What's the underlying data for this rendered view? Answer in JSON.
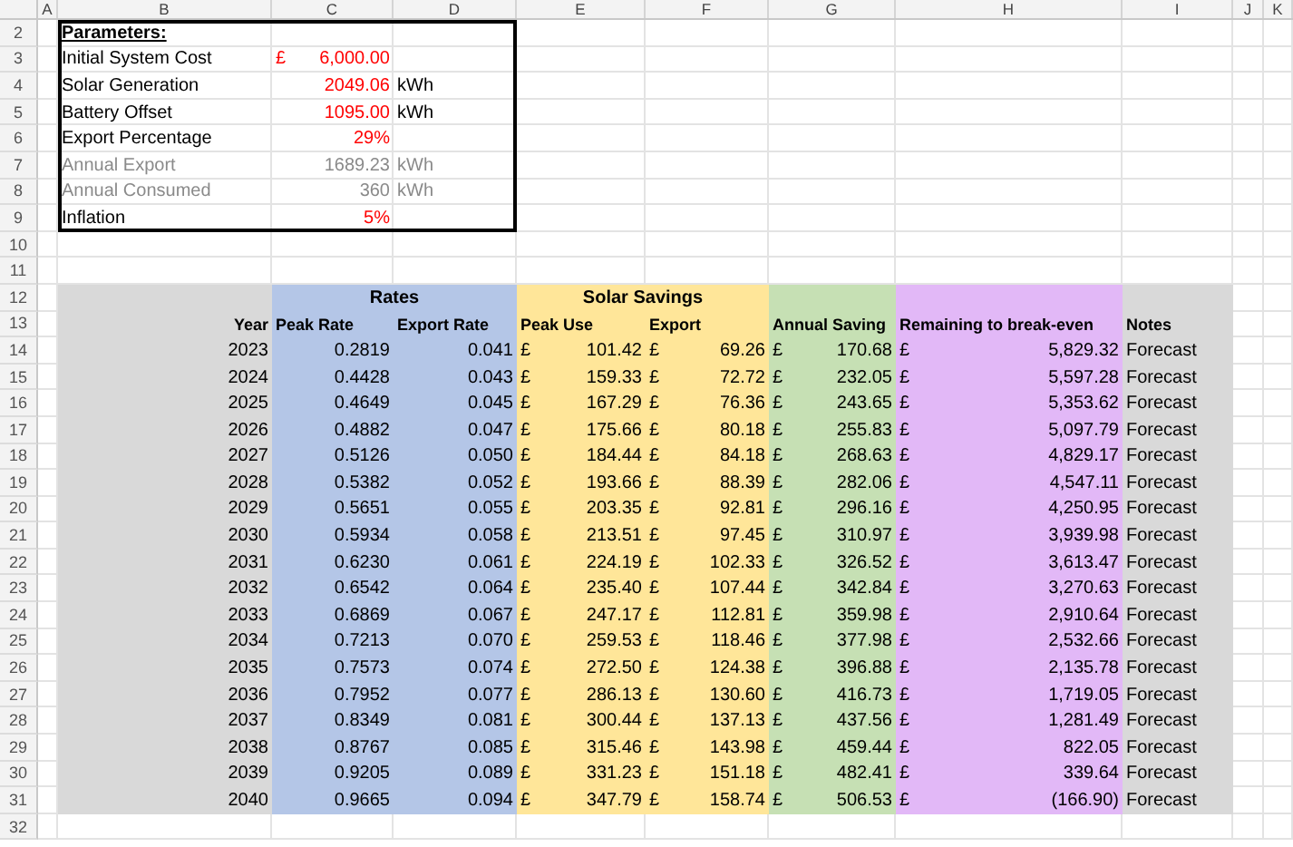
{
  "column_headers": [
    "A",
    "B",
    "C",
    "D",
    "E",
    "F",
    "G",
    "H",
    "I",
    "J",
    "K"
  ],
  "row_numbers": [
    "2",
    "3",
    "4",
    "5",
    "6",
    "7",
    "8",
    "9",
    "10",
    "11",
    "12",
    "13",
    "14",
    "15",
    "16",
    "17",
    "18",
    "19",
    "20",
    "21",
    "22",
    "23",
    "24",
    "25",
    "26",
    "27",
    "28",
    "29",
    "30",
    "31",
    "32"
  ],
  "parameters": {
    "title": "Parameters:",
    "items": [
      {
        "label": "Initial System Cost",
        "currency": "£",
        "value": "6,000.00",
        "muted": false
      },
      {
        "label": "Solar Generation",
        "value": "2049.06",
        "unit": "kWh",
        "muted": false
      },
      {
        "label": "Battery Offset",
        "value": "1095.00",
        "unit": "kWh",
        "muted": false
      },
      {
        "label": "Export Percentage",
        "value": "29%",
        "muted": false
      },
      {
        "label": "Annual Export",
        "value": "1689.23",
        "unit": "kWh",
        "muted": true
      },
      {
        "label": "Annual Consumed",
        "value": "360",
        "unit": "kWh",
        "muted": true
      },
      {
        "label": "Inflation",
        "value": "5%",
        "muted": false
      }
    ]
  },
  "table": {
    "groups": [
      "Rates",
      "Solar Savings"
    ],
    "columns": [
      "Year",
      "Peak Rate",
      "Export Rate",
      "Peak Use",
      "Export",
      "Annual Saving",
      "Remaining to break-even",
      "Notes"
    ],
    "rows": [
      {
        "year": "2023",
        "peak_rate": "0.2819",
        "export_rate": "0.041",
        "peak_use": [
          "£",
          "101.42"
        ],
        "export": [
          "£",
          "69.26"
        ],
        "annual_saving": [
          "£",
          "170.68"
        ],
        "remaining": [
          "£",
          "5,829.32"
        ],
        "notes": "Forecast"
      },
      {
        "year": "2024",
        "peak_rate": "0.4428",
        "export_rate": "0.043",
        "peak_use": [
          "£",
          "159.33"
        ],
        "export": [
          "£",
          "72.72"
        ],
        "annual_saving": [
          "£",
          "232.05"
        ],
        "remaining": [
          "£",
          "5,597.28"
        ],
        "notes": "Forecast"
      },
      {
        "year": "2025",
        "peak_rate": "0.4649",
        "export_rate": "0.045",
        "peak_use": [
          "£",
          "167.29"
        ],
        "export": [
          "£",
          "76.36"
        ],
        "annual_saving": [
          "£",
          "243.65"
        ],
        "remaining": [
          "£",
          "5,353.62"
        ],
        "notes": "Forecast"
      },
      {
        "year": "2026",
        "peak_rate": "0.4882",
        "export_rate": "0.047",
        "peak_use": [
          "£",
          "175.66"
        ],
        "export": [
          "£",
          "80.18"
        ],
        "annual_saving": [
          "£",
          "255.83"
        ],
        "remaining": [
          "£",
          "5,097.79"
        ],
        "notes": "Forecast"
      },
      {
        "year": "2027",
        "peak_rate": "0.5126",
        "export_rate": "0.050",
        "peak_use": [
          "£",
          "184.44"
        ],
        "export": [
          "£",
          "84.18"
        ],
        "annual_saving": [
          "£",
          "268.63"
        ],
        "remaining": [
          "£",
          "4,829.17"
        ],
        "notes": "Forecast"
      },
      {
        "year": "2028",
        "peak_rate": "0.5382",
        "export_rate": "0.052",
        "peak_use": [
          "£",
          "193.66"
        ],
        "export": [
          "£",
          "88.39"
        ],
        "annual_saving": [
          "£",
          "282.06"
        ],
        "remaining": [
          "£",
          "4,547.11"
        ],
        "notes": "Forecast"
      },
      {
        "year": "2029",
        "peak_rate": "0.5651",
        "export_rate": "0.055",
        "peak_use": [
          "£",
          "203.35"
        ],
        "export": [
          "£",
          "92.81"
        ],
        "annual_saving": [
          "£",
          "296.16"
        ],
        "remaining": [
          "£",
          "4,250.95"
        ],
        "notes": "Forecast"
      },
      {
        "year": "2030",
        "peak_rate": "0.5934",
        "export_rate": "0.058",
        "peak_use": [
          "£",
          "213.51"
        ],
        "export": [
          "£",
          "97.45"
        ],
        "annual_saving": [
          "£",
          "310.97"
        ],
        "remaining": [
          "£",
          "3,939.98"
        ],
        "notes": "Forecast"
      },
      {
        "year": "2031",
        "peak_rate": "0.6230",
        "export_rate": "0.061",
        "peak_use": [
          "£",
          "224.19"
        ],
        "export": [
          "£",
          "102.33"
        ],
        "annual_saving": [
          "£",
          "326.52"
        ],
        "remaining": [
          "£",
          "3,613.47"
        ],
        "notes": "Forecast"
      },
      {
        "year": "2032",
        "peak_rate": "0.6542",
        "export_rate": "0.064",
        "peak_use": [
          "£",
          "235.40"
        ],
        "export": [
          "£",
          "107.44"
        ],
        "annual_saving": [
          "£",
          "342.84"
        ],
        "remaining": [
          "£",
          "3,270.63"
        ],
        "notes": "Forecast"
      },
      {
        "year": "2033",
        "peak_rate": "0.6869",
        "export_rate": "0.067",
        "peak_use": [
          "£",
          "247.17"
        ],
        "export": [
          "£",
          "112.81"
        ],
        "annual_saving": [
          "£",
          "359.98"
        ],
        "remaining": [
          "£",
          "2,910.64"
        ],
        "notes": "Forecast"
      },
      {
        "year": "2034",
        "peak_rate": "0.7213",
        "export_rate": "0.070",
        "peak_use": [
          "£",
          "259.53"
        ],
        "export": [
          "£",
          "118.46"
        ],
        "annual_saving": [
          "£",
          "377.98"
        ],
        "remaining": [
          "£",
          "2,532.66"
        ],
        "notes": "Forecast"
      },
      {
        "year": "2035",
        "peak_rate": "0.7573",
        "export_rate": "0.074",
        "peak_use": [
          "£",
          "272.50"
        ],
        "export": [
          "£",
          "124.38"
        ],
        "annual_saving": [
          "£",
          "396.88"
        ],
        "remaining": [
          "£",
          "2,135.78"
        ],
        "notes": "Forecast"
      },
      {
        "year": "2036",
        "peak_rate": "0.7952",
        "export_rate": "0.077",
        "peak_use": [
          "£",
          "286.13"
        ],
        "export": [
          "£",
          "130.60"
        ],
        "annual_saving": [
          "£",
          "416.73"
        ],
        "remaining": [
          "£",
          "1,719.05"
        ],
        "notes": "Forecast"
      },
      {
        "year": "2037",
        "peak_rate": "0.8349",
        "export_rate": "0.081",
        "peak_use": [
          "£",
          "300.44"
        ],
        "export": [
          "£",
          "137.13"
        ],
        "annual_saving": [
          "£",
          "437.56"
        ],
        "remaining": [
          "£",
          "1,281.49"
        ],
        "notes": "Forecast"
      },
      {
        "year": "2038",
        "peak_rate": "0.8767",
        "export_rate": "0.085",
        "peak_use": [
          "£",
          "315.46"
        ],
        "export": [
          "£",
          "143.98"
        ],
        "annual_saving": [
          "£",
          "459.44"
        ],
        "remaining": [
          "£",
          "822.05"
        ],
        "notes": "Forecast"
      },
      {
        "year": "2039",
        "peak_rate": "0.9205",
        "export_rate": "0.089",
        "peak_use": [
          "£",
          "331.23"
        ],
        "export": [
          "£",
          "151.18"
        ],
        "annual_saving": [
          "£",
          "482.41"
        ],
        "remaining": [
          "£",
          "339.64"
        ],
        "notes": "Forecast"
      },
      {
        "year": "2040",
        "peak_rate": "0.9665",
        "export_rate": "0.094",
        "peak_use": [
          "£",
          "347.79"
        ],
        "export": [
          "£",
          "158.74"
        ],
        "annual_saving": [
          "£",
          "506.53"
        ],
        "remaining": [
          "£",
          "(166.90)"
        ],
        "notes": "Forecast"
      }
    ]
  }
}
